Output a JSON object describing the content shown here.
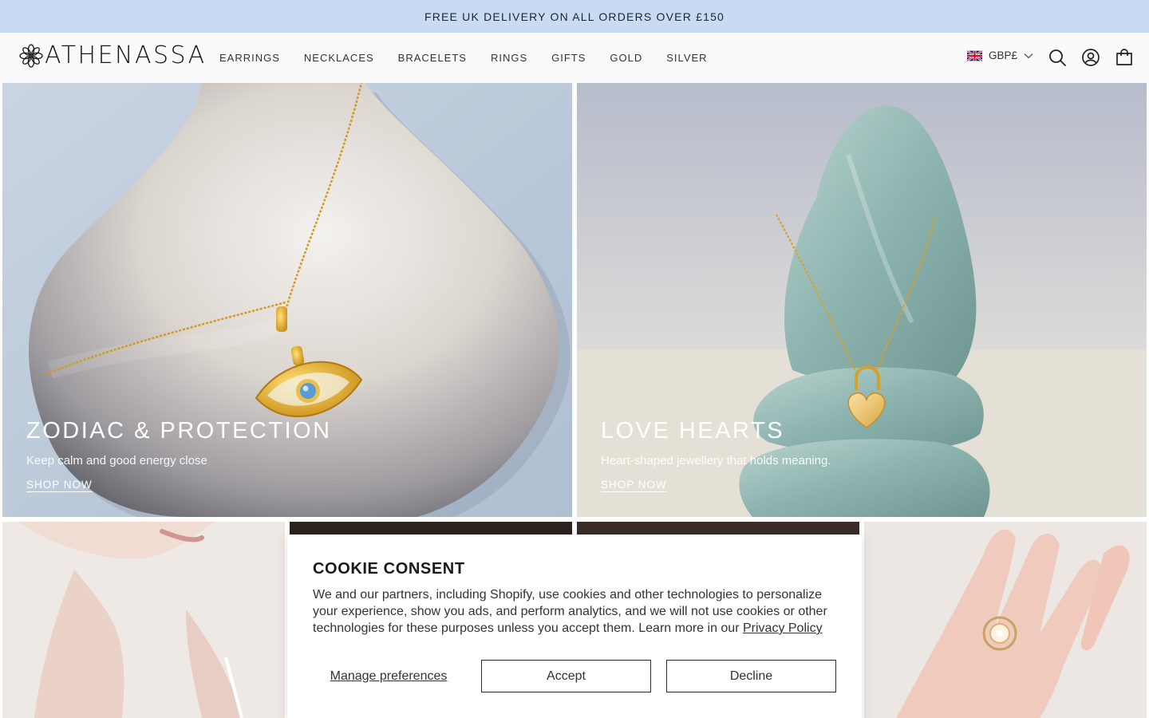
{
  "announcement": "FREE UK DELIVERY ON ALL ORDERS OVER £150",
  "brand": {
    "name": "ATHENASSA",
    "accent": "#c8dbf3"
  },
  "nav": {
    "items": [
      {
        "label": "EARRINGS"
      },
      {
        "label": "NECKLACES"
      },
      {
        "label": "BRACELETS"
      },
      {
        "label": "RINGS"
      },
      {
        "label": "GIFTS"
      },
      {
        "label": "GOLD"
      },
      {
        "label": "SILVER"
      }
    ]
  },
  "header": {
    "currency": "GBP£",
    "icons": [
      "uk-flag-icon",
      "chevron-down-icon",
      "search-icon",
      "account-icon",
      "cart-icon"
    ]
  },
  "hero": [
    {
      "title": "ZODIAC & PROTECTION",
      "subtitle": "Keep calm and good energy close",
      "cta": "SHOP NOW"
    },
    {
      "title": "LOVE HEARTS",
      "subtitle": "Heart-shaped jewellery that holds meaning.",
      "cta": "SHOP NOW"
    }
  ],
  "cookie": {
    "title": "COOKIE CONSENT",
    "text": "We and our partners, including Shopify, use cookies and other technologies to personalize your experience, show you ads, and perform analytics, and we will not use cookies or other technologies for these purposes unless you accept them. Learn more in our ",
    "policy_link": "Privacy Policy",
    "manage": "Manage preferences",
    "accept": "Accept",
    "decline": "Decline"
  }
}
